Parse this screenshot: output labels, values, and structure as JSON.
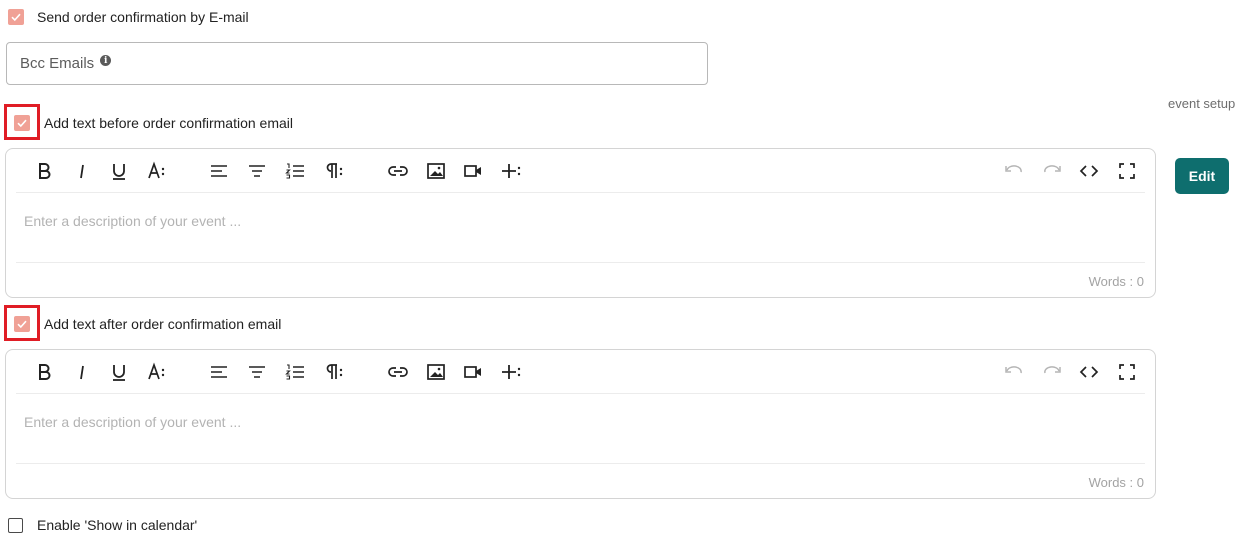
{
  "send_confirmation": {
    "label": "Send order confirmation by E-mail",
    "checked": true
  },
  "bcc": {
    "label": "Bcc Emails",
    "info_icon": "info-icon"
  },
  "side": {
    "event_setup": "event setup",
    "edit_label": "Edit"
  },
  "before_text": {
    "label": "Add text before order confirmation email",
    "checked": true
  },
  "after_text": {
    "label": "Add text after order confirmation email",
    "checked": true
  },
  "editor": {
    "placeholder": "Enter a description of your event ...",
    "words_label": "Words : 0",
    "toolbar": [
      "bold-icon",
      "italic-icon",
      "underline-icon",
      "font-size-icon",
      "align-left-icon",
      "align-center-icon",
      "ordered-list-icon",
      "paragraph-format-icon",
      "link-icon",
      "image-icon",
      "video-icon",
      "more-icon",
      "undo-icon",
      "redo-icon",
      "code-view-icon",
      "fullscreen-icon"
    ]
  },
  "show_calendar": {
    "label": "Enable 'Show in calendar'",
    "checked": false
  },
  "colors": {
    "check_fill": "#f0a196",
    "highlight": "#e01d25",
    "edit_button": "#0e6e6e"
  }
}
